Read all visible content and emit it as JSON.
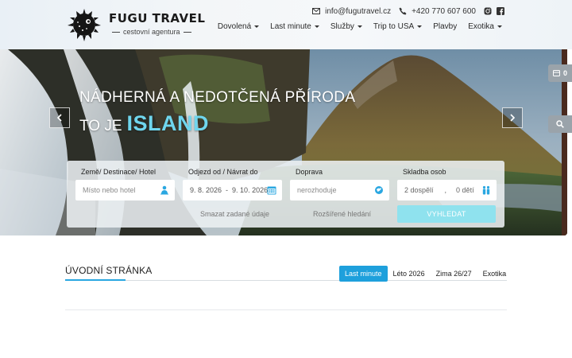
{
  "header": {
    "logo_name": "FUGU TRAVEL",
    "logo_tagline": "cestovní agentura",
    "email": "info@fugutravel.cz",
    "phone": "+420 770 607 600",
    "icons": [
      "envelope-icon",
      "phone-icon",
      "instagram-icon",
      "facebook-icon"
    ]
  },
  "nav": {
    "items": [
      {
        "label": "Dovolená",
        "dropdown": true
      },
      {
        "label": "Last minute",
        "dropdown": true
      },
      {
        "label": "Služby",
        "dropdown": true
      },
      {
        "label": "Trip to USA",
        "dropdown": true
      },
      {
        "label": "Plavby",
        "dropdown": false
      },
      {
        "label": "Exotika",
        "dropdown": true
      }
    ]
  },
  "hero": {
    "line1": "NÁDHERNÁ A NEDOTČENÁ PŘÍRODA",
    "line2_prefix": "TO JE",
    "line2_accent": "ISLAND",
    "cart_count": "0"
  },
  "search": {
    "destination_label": "Země/ Destinace/ Hotel",
    "destination_placeholder": "Místo nebo hotel",
    "dates_label": "Odjezd od / Návrat do",
    "date_from": "9. 8. 2026",
    "date_separator": "-",
    "date_to": "9. 10. 2026",
    "transport_label": "Doprava",
    "transport_value": "nerozhoduje",
    "people_label": "Skladba osob",
    "adults": "2 dospělí",
    "people_separator": ",",
    "children": "0 dětí",
    "clear_link": "Smazat zadané údaje",
    "advanced_link": "Rozšířené hledání",
    "search_button": "VYHLEDAT"
  },
  "content": {
    "title": "ÚVODNÍ STRÁNKA",
    "tabs": [
      {
        "label": "Last minute",
        "active": true
      },
      {
        "label": "Léto 2026",
        "active": false
      },
      {
        "label": "Zima 26/27",
        "active": false
      },
      {
        "label": "Exotika",
        "active": false
      }
    ]
  },
  "colors": {
    "accent": "#6fd6ee",
    "tab_active": "#1ea0dc",
    "search_button": "#8fe2ee",
    "field_icon": "#2aa7e1"
  }
}
